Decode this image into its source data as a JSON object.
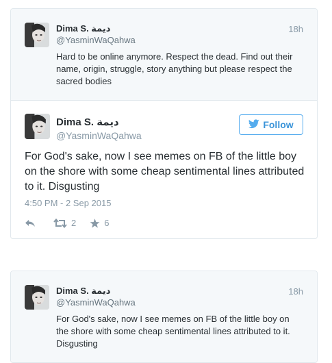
{
  "tweet_top_quote": {
    "name": "Dima S. ديمة",
    "handle": "@YasminWaQahwa",
    "time": "18h",
    "text": "Hard to be online anymore. Respect the dead. Find out their name, origin, struggle, story anything but please respect the sacred bodies"
  },
  "tweet_main": {
    "name": "Dima S. ديمة",
    "handle": "@YasminWaQahwa",
    "follow_label": "Follow",
    "text": "For God's sake, now I see memes on FB of the little boy on the shore with some cheap sentimental lines attributed to it. Disgusting",
    "timestamp": "4:50 PM - 2 Sep 2015",
    "retweet_count": "2",
    "favorite_count": "6"
  },
  "tweet_bottom_quote": {
    "name": "Dima S. ديمة",
    "handle": "@YasminWaQahwa",
    "time": "18h",
    "text": "For God's sake, now I see memes on FB of the little boy on the shore with some cheap sentimental lines attributed to it. Disgusting"
  },
  "colors": {
    "accent": "#55acee",
    "muted": "#8899a6",
    "quote_bg": "#f5f8fa",
    "border": "#e1e8ed"
  },
  "icons": [
    "twitter-bird-icon",
    "reply-icon",
    "retweet-icon",
    "favorite-star-icon"
  ]
}
